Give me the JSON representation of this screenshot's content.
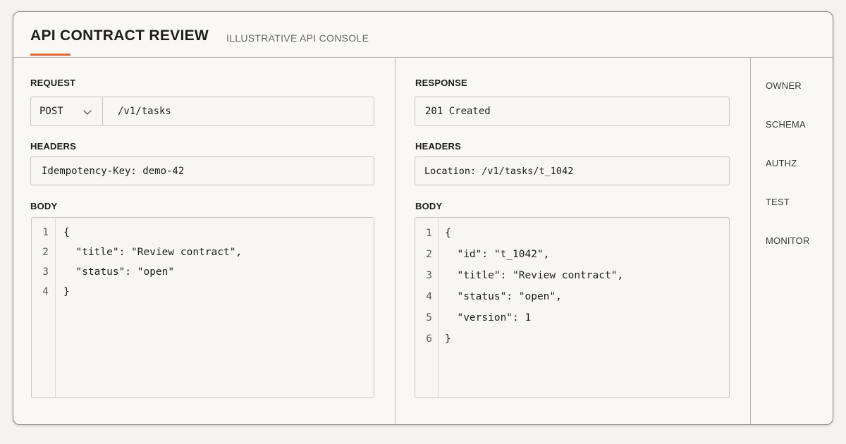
{
  "header": {
    "title": "API CONTRACT REVIEW",
    "subtitle": "ILLUSTRATIVE API CONSOLE"
  },
  "colors": {
    "accent": "#e06a35",
    "border": "#bdbbb6",
    "background": "#f9f8f5"
  },
  "request": {
    "label": "REQUEST",
    "method": "POST",
    "method_icon": "chevron-down-icon",
    "url": "/v1/tasks",
    "headers_label": "HEADERS",
    "headers_value": "Idempotency-Key: demo-42",
    "body_label": "BODY",
    "body_lines": [
      {
        "n": "1",
        "text": "{"
      },
      {
        "n": "2",
        "text": "  \"title\": \"Review contract\","
      },
      {
        "n": "3",
        "text": "  \"status\": \"open\""
      },
      {
        "n": "4",
        "text": "}"
      }
    ]
  },
  "response": {
    "label": "RESPONSE",
    "status": "201 Created",
    "headers_label": "HEADERS",
    "headers_value": "Location: /v1/tasks/t_1042",
    "body_label": "BODY",
    "body_lines": [
      {
        "n": "1",
        "text": "{"
      },
      {
        "n": "2",
        "text": "  \"id\": \"t_1042\","
      },
      {
        "n": "3",
        "text": "  \"title\": \"Review contract\","
      },
      {
        "n": "4",
        "text": "  \"status\": \"open\","
      },
      {
        "n": "5",
        "text": "  \"version\": 1"
      },
      {
        "n": "6",
        "text": "}"
      }
    ]
  },
  "sidebar": {
    "items": [
      {
        "label": "OWNER"
      },
      {
        "label": "SCHEMA"
      },
      {
        "label": "AUTHZ"
      },
      {
        "label": "TEST"
      },
      {
        "label": "MONITOR"
      }
    ]
  }
}
